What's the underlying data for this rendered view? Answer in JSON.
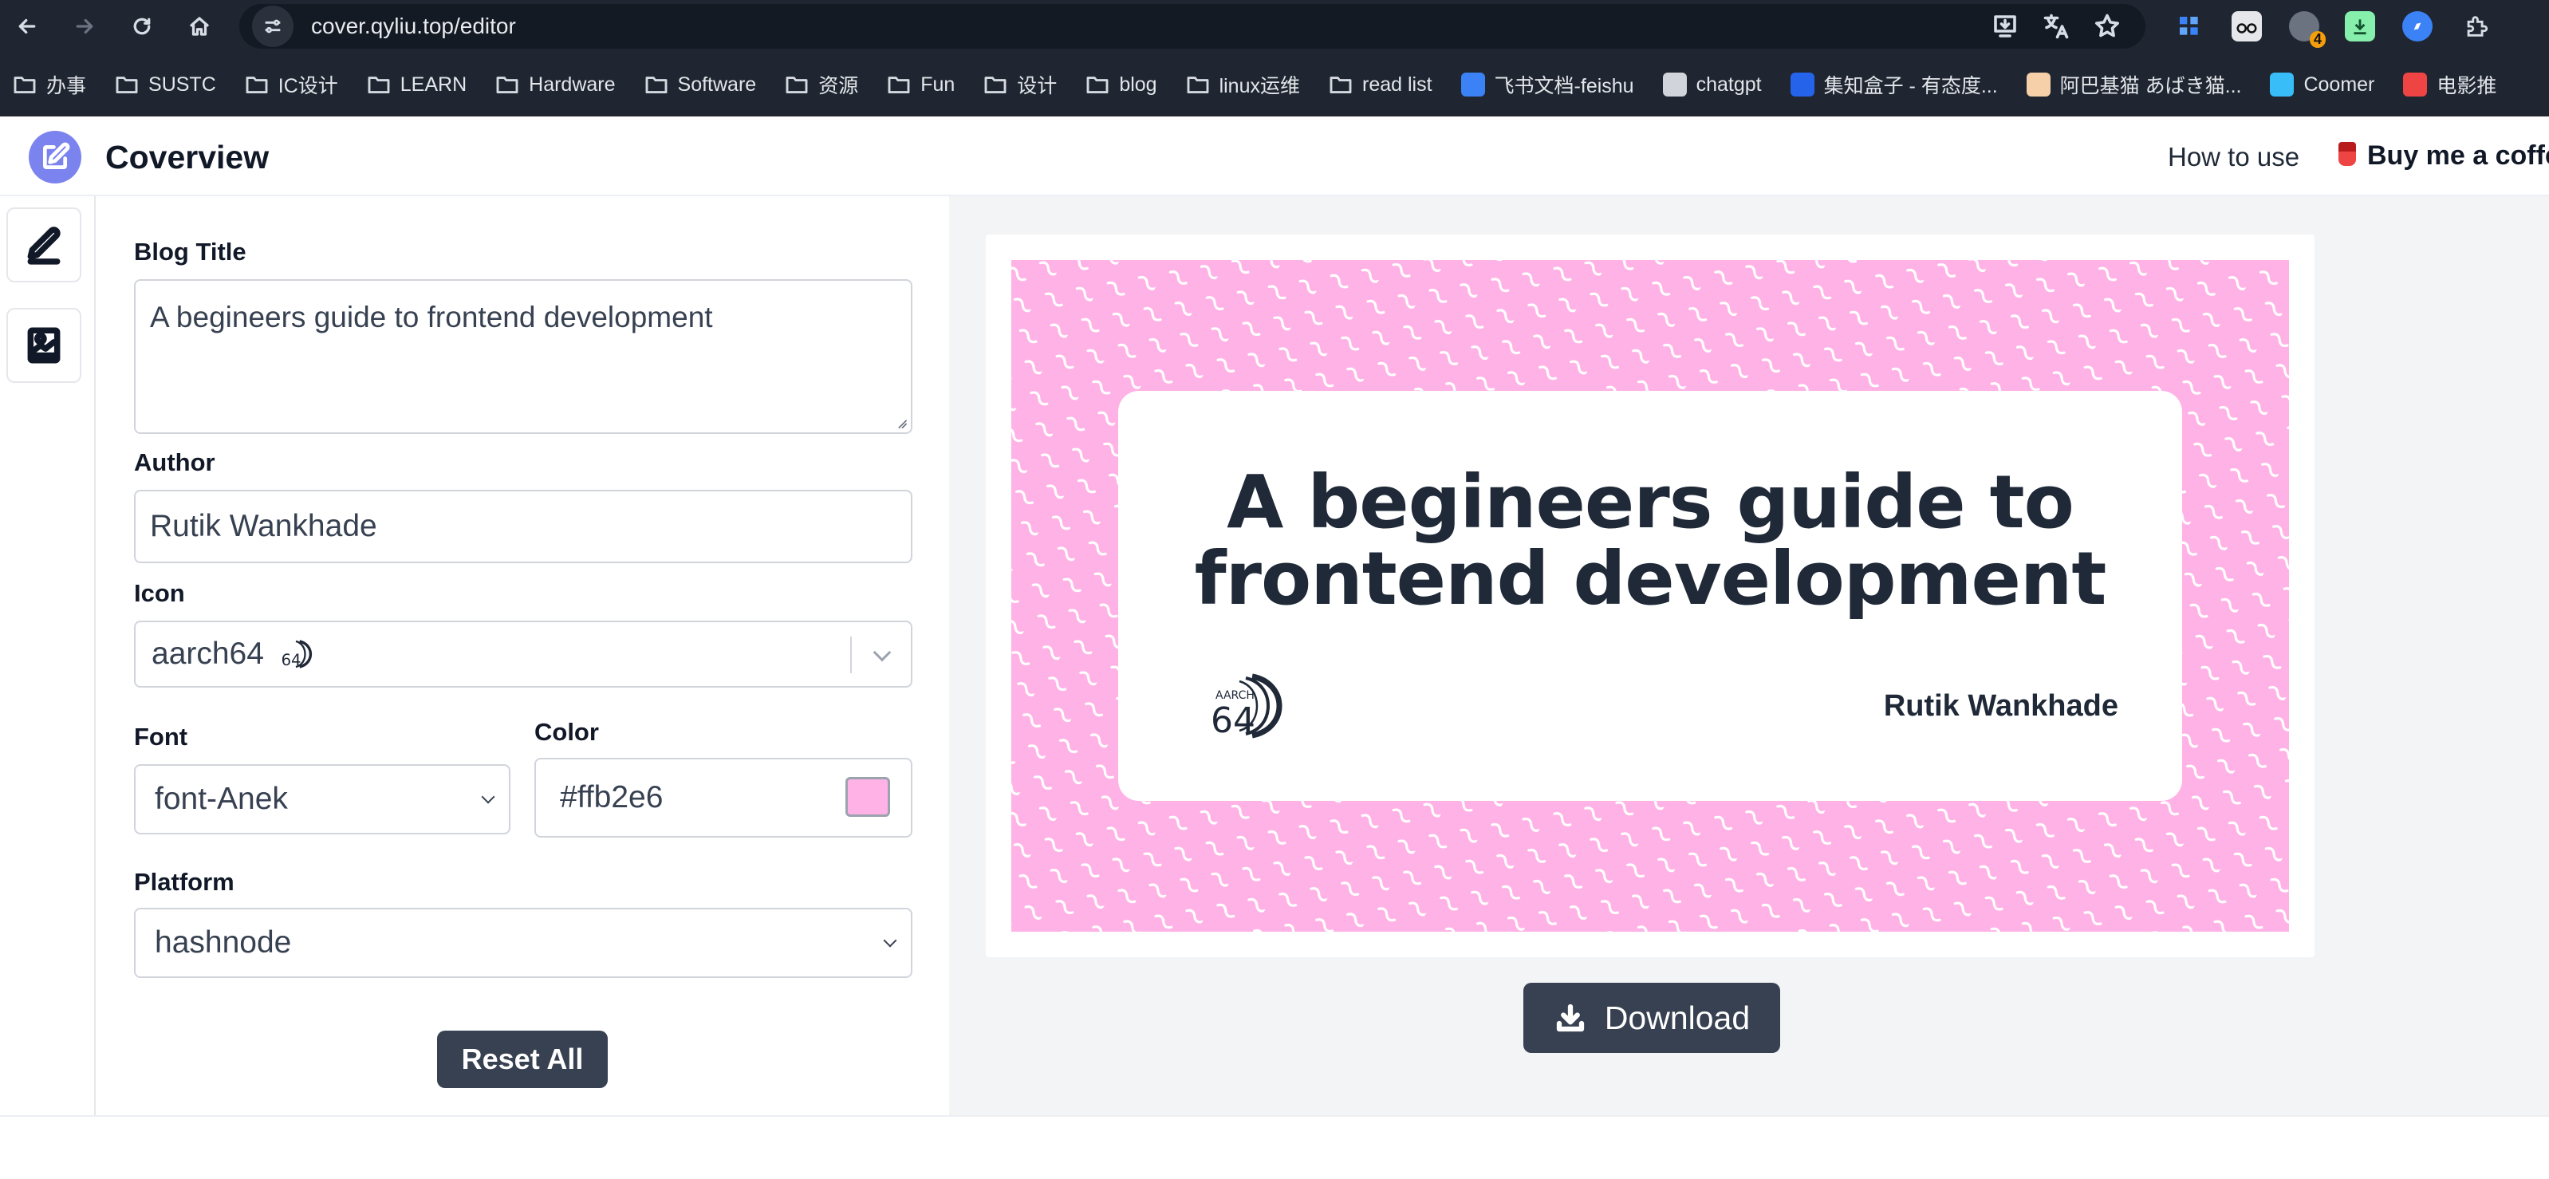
{
  "browser": {
    "url": "cover.qyliu.top/editor",
    "extension_badge": "4",
    "bookmarks": [
      {
        "label": "办事",
        "type": "folder"
      },
      {
        "label": "SUSTC",
        "type": "folder"
      },
      {
        "label": "IC设计",
        "type": "folder"
      },
      {
        "label": "LEARN",
        "type": "folder"
      },
      {
        "label": "Hardware",
        "type": "folder"
      },
      {
        "label": "Software",
        "type": "folder"
      },
      {
        "label": "资源",
        "type": "folder"
      },
      {
        "label": "Fun",
        "type": "folder"
      },
      {
        "label": "设计",
        "type": "folder"
      },
      {
        "label": "blog",
        "type": "folder"
      },
      {
        "label": "linux运维",
        "type": "folder"
      },
      {
        "label": "read list",
        "type": "folder"
      },
      {
        "label": "飞书文档-feishu",
        "type": "site"
      },
      {
        "label": "chatgpt",
        "type": "site"
      },
      {
        "label": "集知盒子 - 有态度...",
        "type": "site"
      },
      {
        "label": "阿巴基猫 あばき猫...",
        "type": "site"
      },
      {
        "label": "Coomer",
        "type": "site"
      },
      {
        "label": "电影推",
        "type": "site"
      }
    ]
  },
  "header": {
    "brand": "Coverview",
    "how_to_use": "How to use",
    "buy_coffee": "Buy me a coffee"
  },
  "form": {
    "title_label": "Blog Title",
    "title_value": "A begineers guide to frontend development",
    "author_label": "Author",
    "author_value": "Rutik Wankhade",
    "icon_label": "Icon",
    "icon_value": "aarch64",
    "font_label": "Font",
    "font_value": "font-Anek",
    "color_label": "Color",
    "color_value": "#ffb2e6",
    "platform_label": "Platform",
    "platform_value": "hashnode",
    "reset_label": "Reset All"
  },
  "preview": {
    "title": "A begineers guide to frontend development",
    "author": "Rutik Wankhade",
    "icon_text_top": "AARCH",
    "icon_text_num": "64",
    "background_color": "#ffb2e6",
    "download_label": "Download"
  },
  "colors": {
    "accent": "#7b83ee",
    "button": "#374151",
    "cover_bg": "#ffb2e6"
  }
}
